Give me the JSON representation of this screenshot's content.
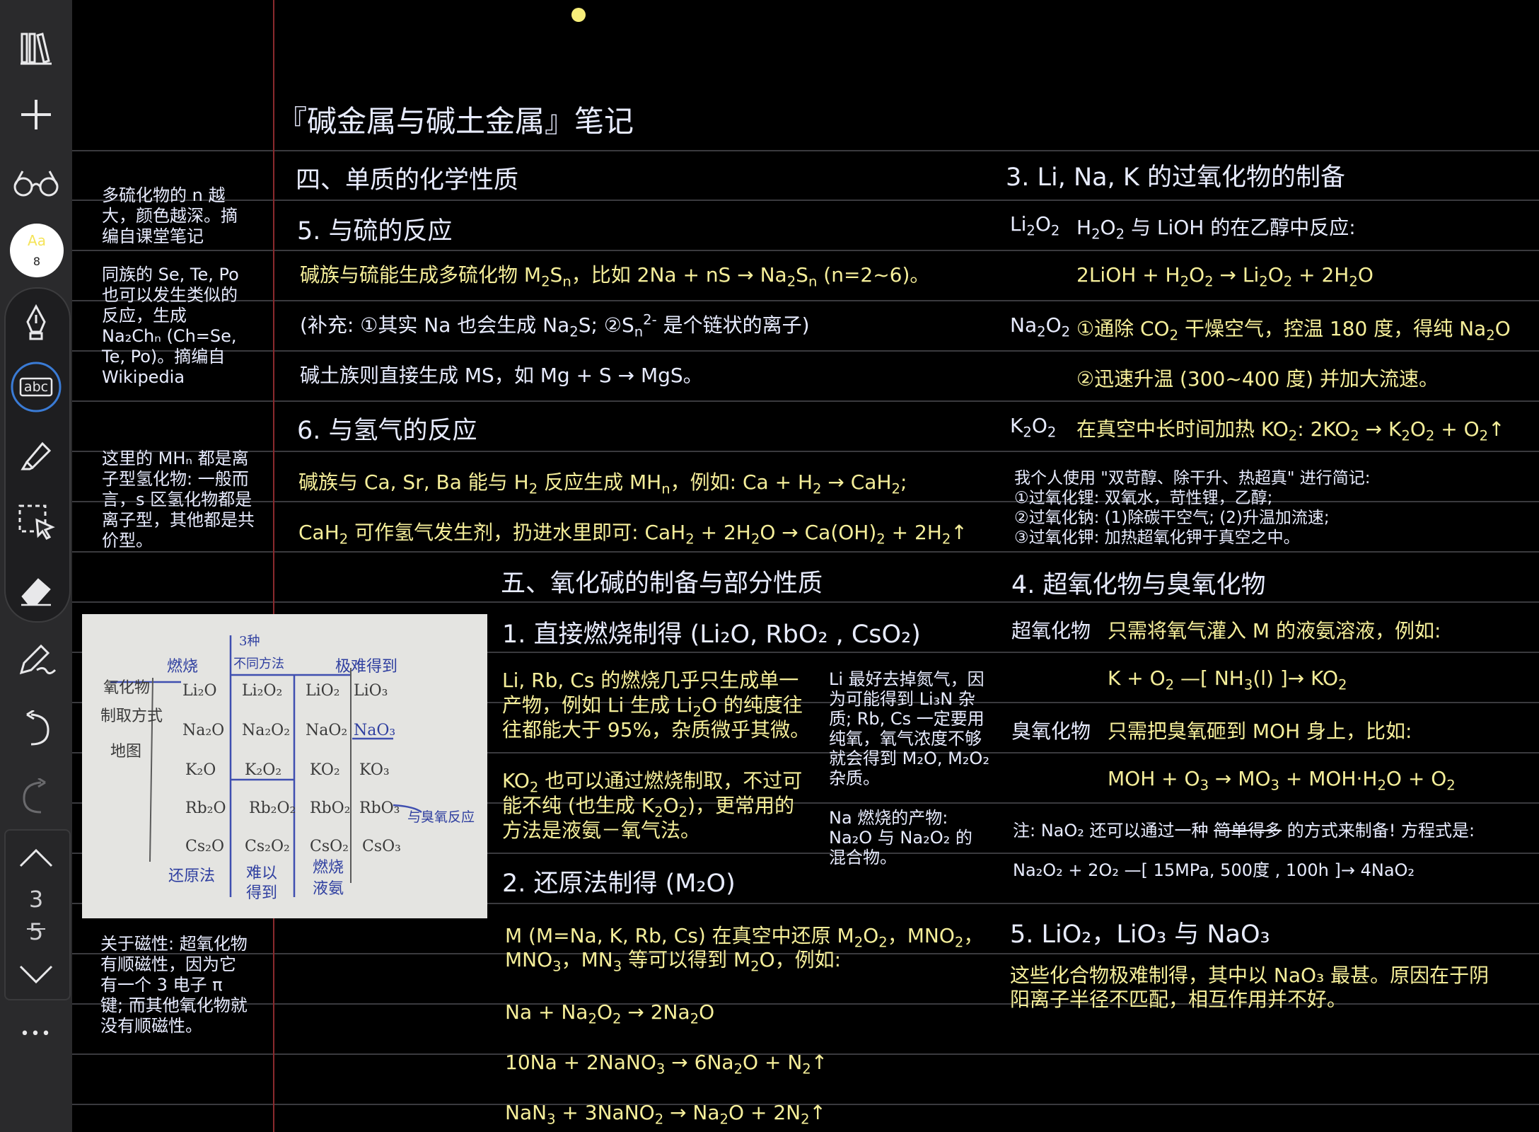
{
  "toolbar": {
    "icons": [
      "library-icon",
      "add-icon",
      "reading-glasses-icon",
      "text-style-icon",
      "fountain-pen-icon",
      "text-box-icon",
      "highlighter-icon",
      "lasso-select-icon",
      "eraser-icon",
      "pen-settings-icon",
      "undo-icon",
      "redo-icon",
      "page-up-icon",
      "page-down-icon",
      "more-icon"
    ],
    "text_style_aa": "Aa",
    "text_style_size": "8",
    "text_box_label": "abc",
    "page_current": "3",
    "page_total": "5",
    "more": "•••"
  },
  "title": "『碱金属与碱土金属』笔记",
  "sec4": {
    "heading": "四、单质的化学性质",
    "s5_heading": "5. 与硫的反应",
    "s6_heading": "6. 与氢气的反应"
  },
  "sec5": {
    "heading": "五、氧化碱的制备与部分性质",
    "s1_heading": "1. 直接燃烧制得 (Li₂O, RbO₂ , CsO₂)",
    "s2_heading": "2. 还原法制得 (M₂O)"
  },
  "right": {
    "s3_heading": "3. Li, Na, K 的过氧化物的制备",
    "s4_heading": "4. 超氧化物与臭氧化物",
    "s5_heading": "5. LiO₂，LiO₃ 与 NaO₃",
    "li2o2_label": "Li₂O₂",
    "na2o2_label": "Na₂O₂",
    "k2o2_label": "K₂O₂",
    "superoxide_label": "超氧化物",
    "ozonide_label": "臭氧化物",
    "memo": [
      "我个人使用 \"双苛醇、除干升、热超真\" 进行简记:",
      "①过氧化锂: 双氧水，苛性锂，乙醇;",
      "②过氧化钠: (1)除碳干空气; (2)升温加流速;",
      "③过氧化钾: 加热超氧化钾于真空之中。"
    ],
    "note_prefix": "注: NaO₂ 还可以通过一种 ",
    "note_strike": "简单得多",
    "note_suffix": " 的方式来制备! 方程式是:",
    "note_eq": "Na₂O₂ + 2O₂ —[ 15MPa, 500度 , 100h ]→ 4NaO₂",
    "s5_text": "这些化合物极难制得，其中以 NaO₃ 最甚。原因在于阴阳离子半径不匹配，相互作用并不好。"
  },
  "margin_notes": {
    "n1": "多硫化物的 n 越大，颜色越深。摘编自课堂笔记",
    "n2": "同族的 Se, Te, Po 也可以发生类似的反应，生成 Na₂Chₙ (Ch=Se, Te, Po)。摘编自 Wikipedia",
    "n3": "这里的 MHₙ 都是离子型氢化物: 一般而言，s 区氢化物都是离子型，其他都是共价型。",
    "n4": "关于磁性: 超氧化物有顺磁性，因为它有一个 3 电子 π 键; 而其他氧化物就没有顺磁性。",
    "n5": "Li 最好去掉氮气，因为可能得到 Li₃N 杂质; Rb, Cs 一定要用纯氧，氧气浓度不够就会得到 M₂O, M₂O₂ 杂质。",
    "n6": "Na 燃烧的产物: Na₂O 与 Na₂O₂ 的混合物。"
  },
  "photo": {
    "side_label": [
      "氧化物",
      "制取方式",
      "地图"
    ],
    "col_burn": "燃烧",
    "col_three": [
      "3种",
      "不同方法"
    ],
    "col_hard": "极难得到",
    "cells": [
      "Li₂O",
      "Li₂O₂",
      "LiO₂",
      "LiO₃",
      "Na₂O",
      "Na₂O₂",
      "NaO₂",
      "NaO₃",
      "K₂O",
      "K₂O₂",
      "KO₂",
      "KO₃",
      "Rb₂O",
      "Rb₂O₂",
      "RbO₂",
      "RbO₃",
      "Cs₂O",
      "Cs₂O₂",
      "CsO₂",
      "CsO₃"
    ],
    "foot_reduce": "还原法",
    "foot_hard": [
      "难以",
      "得到"
    ],
    "foot_burn": [
      "燃烧",
      "液氨"
    ],
    "ozone": "与臭氧反应"
  },
  "colors": {
    "yellow_text": "#f6ef9a",
    "white_text": "#e8ecff",
    "margin_line": "#8a2a2e",
    "rule_line": "#3a3a3e"
  }
}
